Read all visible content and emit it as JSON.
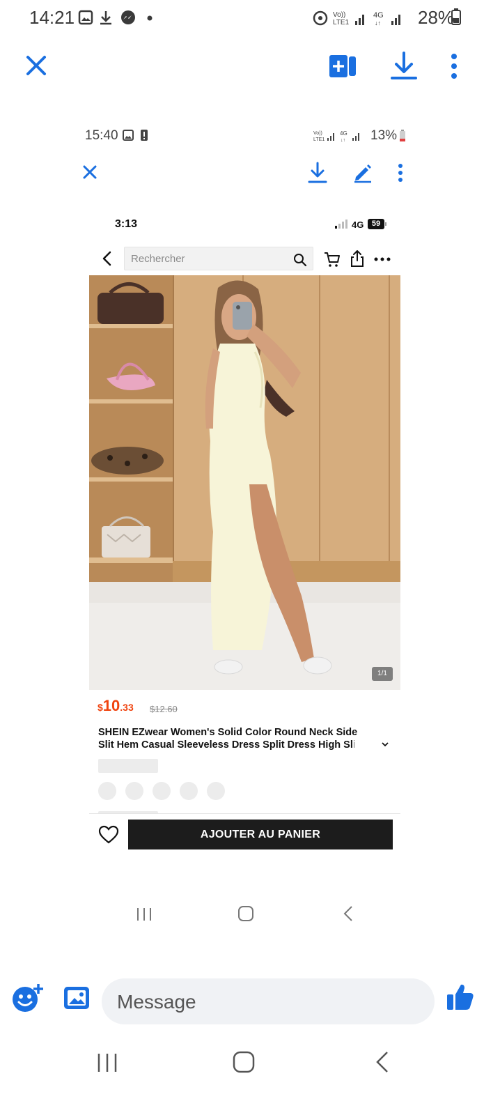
{
  "outer_status": {
    "time": "14:21",
    "network": "Vo)) LTE1",
    "net_type": "4G",
    "battery": "28%"
  },
  "viewer_toolbar": {
    "close_icon": "close-icon",
    "icons": [
      "add-to-drive-icon",
      "download-icon",
      "more-vertical-icon"
    ],
    "accent": "#1a6fe0"
  },
  "inner_status": {
    "time": "15:40",
    "network": "Vo)) LTE1",
    "net_type": "4G",
    "battery": "13%"
  },
  "inner_toolbar": {
    "icons": [
      "close-icon",
      "download-icon",
      "edit-icon",
      "more-vertical-icon"
    ]
  },
  "shop_status": {
    "time": "3:13",
    "net_type": "4G",
    "battery": "59"
  },
  "shop_search": {
    "placeholder": "Rechercher"
  },
  "product": {
    "image_counter": "1/1",
    "price_currency": "$",
    "price_whole": "10",
    "price_cents": ".33",
    "price_old": "$12.60",
    "title_line1": "SHEIN EZwear Women's Solid Color Round Neck Side",
    "title_line2": "Slit Hem Casual Sleeveless Dress Split Dress High Sl",
    "title_faded": "i",
    "add_to_cart": "AJOUTER AU PANIER",
    "price_color": "#f0430f"
  },
  "messenger": {
    "placeholder": "Message",
    "accent": "#1a6fe0"
  }
}
